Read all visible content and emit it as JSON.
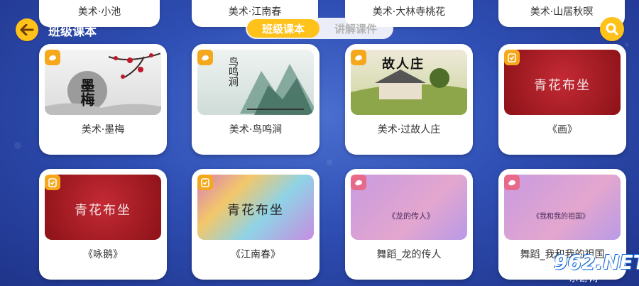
{
  "header": {
    "title": "班级课本",
    "tabs": [
      {
        "label": "班级课本",
        "active": true
      },
      {
        "label": "讲解课件",
        "active": false
      }
    ]
  },
  "top_row": [
    {
      "label": "美术·小池"
    },
    {
      "label": "美术·江南春"
    },
    {
      "label": "美术·大林寺桃花"
    },
    {
      "label": "美术·山居秋暝"
    }
  ],
  "cards": [
    {
      "label": "美术·墨梅",
      "thumb_text": "墨梅"
    },
    {
      "label": "美术·鸟鸣涧",
      "thumb_text": "鸟鸣涧"
    },
    {
      "label": "美术·过故人庄",
      "thumb_text": "故人庄"
    },
    {
      "label": "《画》",
      "thumb_text": "青花布坐"
    },
    {
      "label": "《咏鹅》",
      "thumb_text": "青花布坐"
    },
    {
      "label": "《江南春》",
      "thumb_text": "青花布坐"
    },
    {
      "label": "舞蹈_龙的传人",
      "thumb_text": "《龙的传人》"
    },
    {
      "label": "舞蹈_我和我的祖国",
      "thumb_text": "《我和我的祖国》"
    }
  ],
  "watermark": {
    "main": "962.NET",
    "sub": "乐游网"
  },
  "colors": {
    "accent": "#ffc21a",
    "background": "#2f4fb4"
  }
}
